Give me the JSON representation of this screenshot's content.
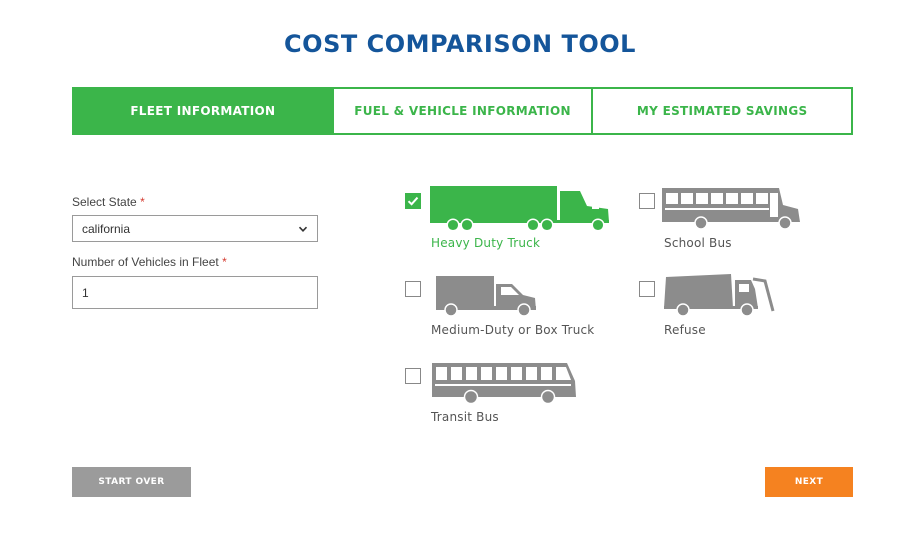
{
  "page": {
    "title": "COST COMPARISON TOOL"
  },
  "tabs": [
    {
      "label": "FLEET INFORMATION",
      "active": true
    },
    {
      "label": "FUEL & VEHICLE INFORMATION",
      "active": false
    },
    {
      "label": "MY ESTIMATED SAVINGS",
      "active": false
    }
  ],
  "form": {
    "state": {
      "label": "Select State",
      "required_mark": "*",
      "value": "california"
    },
    "vehicles_count": {
      "label": "Number of Vehicles in Fleet",
      "required_mark": "*",
      "value": "1"
    }
  },
  "vehicle_types": [
    {
      "label": "Heavy Duty Truck",
      "checked": true,
      "icon": "heavy-duty-truck-icon"
    },
    {
      "label": "School Bus",
      "checked": false,
      "icon": "school-bus-icon"
    },
    {
      "label": "Medium-Duty or Box Truck",
      "checked": false,
      "icon": "box-truck-icon"
    },
    {
      "label": "Refuse",
      "checked": false,
      "icon": "refuse-truck-icon"
    },
    {
      "label": "Transit Bus",
      "checked": false,
      "icon": "transit-bus-icon"
    }
  ],
  "buttons": {
    "start_over": "START OVER",
    "next": "NEXT"
  },
  "colors": {
    "title": "#14559a",
    "accent_green": "#3bb54a",
    "vehicle_gray": "#8c8c8c",
    "start_over_bg": "#9b9b9b",
    "next_bg": "#f58220",
    "required": "#d43a2f"
  }
}
